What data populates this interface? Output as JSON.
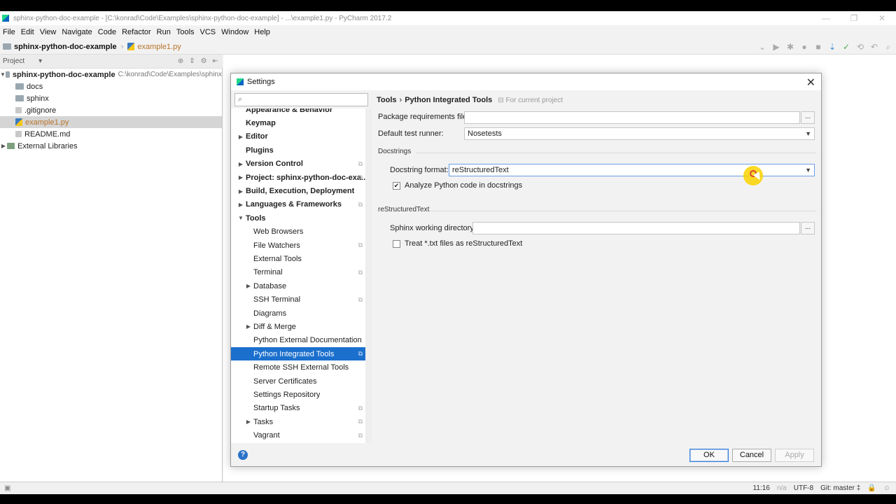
{
  "window": {
    "title": "sphinx-python-doc-example - [C:\\konrad\\Code\\Examples\\sphinx-python-doc-example] - ...\\example1.py - PyCharm 2017.2",
    "controls": [
      "—",
      "❐",
      "✕"
    ]
  },
  "menu": [
    "File",
    "Edit",
    "View",
    "Navigate",
    "Code",
    "Refactor",
    "Run",
    "Tools",
    "VCS",
    "Window",
    "Help"
  ],
  "navbar": {
    "project": "sphinx-python-doc-example",
    "file": "example1.py"
  },
  "project_panel": {
    "header": "Project",
    "tree": [
      {
        "label": "sphinx-python-doc-example",
        "path": "C:\\konrad\\Code\\Examples\\sphinx",
        "type": "folder"
      },
      {
        "label": "docs",
        "type": "folder"
      },
      {
        "label": "sphinx",
        "type": "folder"
      },
      {
        "label": ".gitignore",
        "type": "file"
      },
      {
        "label": "example1.py",
        "type": "py"
      },
      {
        "label": "README.md",
        "type": "file"
      },
      {
        "label": "External Libraries",
        "type": "lib"
      }
    ]
  },
  "status": {
    "position": "11:16",
    "na": "n/a",
    "encoding": "UTF-8",
    "git": "Git: master ‡"
  },
  "dialog": {
    "title": "Settings",
    "search_placeholder": "",
    "tree": [
      {
        "label": "Appearance & Behavior",
        "bold": true,
        "level": 0
      },
      {
        "label": "Keymap",
        "bold": true,
        "level": 0
      },
      {
        "label": "Editor",
        "bold": true,
        "level": 0,
        "arrow": "▶"
      },
      {
        "label": "Plugins",
        "bold": true,
        "level": 0
      },
      {
        "label": "Version Control",
        "bold": true,
        "level": 0,
        "arrow": "▶",
        "cfg": true
      },
      {
        "label": "Project: sphinx-python-doc-exa...",
        "bold": true,
        "level": 0,
        "arrow": "▶",
        "cfg": true
      },
      {
        "label": "Build, Execution, Deployment",
        "bold": true,
        "level": 0,
        "arrow": "▶"
      },
      {
        "label": "Languages & Frameworks",
        "bold": true,
        "level": 0,
        "arrow": "▶",
        "cfg": true
      },
      {
        "label": "Tools",
        "bold": true,
        "level": 0,
        "arrow": "▼"
      },
      {
        "label": "Web Browsers",
        "level": 1
      },
      {
        "label": "File Watchers",
        "level": 1,
        "cfg": true
      },
      {
        "label": "External Tools",
        "level": 1
      },
      {
        "label": "Terminal",
        "level": 1,
        "cfg": true
      },
      {
        "label": "Database",
        "level": 1,
        "arrow": "▶"
      },
      {
        "label": "SSH Terminal",
        "level": 1,
        "cfg": true
      },
      {
        "label": "Diagrams",
        "level": 1
      },
      {
        "label": "Diff & Merge",
        "level": 1,
        "arrow": "▶"
      },
      {
        "label": "Python External Documentation",
        "level": 1
      },
      {
        "label": "Python Integrated Tools",
        "level": 1,
        "cfg": true,
        "selected": true
      },
      {
        "label": "Remote SSH External Tools",
        "level": 1
      },
      {
        "label": "Server Certificates",
        "level": 1
      },
      {
        "label": "Settings Repository",
        "level": 1
      },
      {
        "label": "Startup Tasks",
        "level": 1,
        "cfg": true
      },
      {
        "label": "Tasks",
        "level": 1,
        "arrow": "▶",
        "cfg": true
      },
      {
        "label": "Vagrant",
        "level": 1,
        "cfg": true
      }
    ],
    "breadcrumb": {
      "parent": "Tools",
      "sep": "›",
      "current": "Python Integrated Tools",
      "scope": "For current project"
    },
    "package_requirements": {
      "label": "Package requirements file:",
      "value": "",
      "browse": "..."
    },
    "test_runner": {
      "label": "Default test runner:",
      "value": "Nosetests"
    },
    "docstrings": {
      "section": "Docstrings",
      "format_label": "Docstring format:",
      "format_value": "reStructuredText",
      "analyze_label": "Analyze Python code in docstrings",
      "analyze_checked": true
    },
    "rst": {
      "section": "reStructuredText",
      "sphinx_label": "Sphinx working directory:",
      "sphinx_value": "",
      "browse": "...",
      "treat_txt_label": "Treat *.txt files as reStructuredText",
      "treat_txt_checked": false
    },
    "buttons": {
      "ok": "OK",
      "cancel": "Cancel",
      "apply": "Apply",
      "help": "?"
    }
  }
}
